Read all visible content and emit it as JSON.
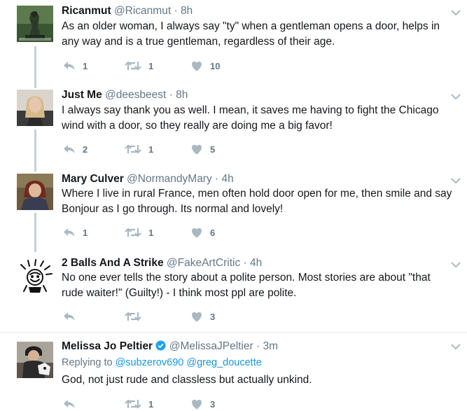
{
  "tweets": [
    {
      "name": "Ricanmut",
      "handle": "@Ricanmut",
      "dot": "·",
      "time": "8h",
      "text": "As an older woman, I always say \"ty\" when a gentleman opens a door, helps in any way and is a true gentleman, regardless of their age.",
      "reply_count": "1",
      "retweet_count": "1",
      "like_count": "10"
    },
    {
      "name": "Just Me",
      "handle": "@deesbeest",
      "dot": "·",
      "time": "8h",
      "text": "I always say thank you as well. I mean, it saves me having to fight the Chicago wind with a door, so they really are doing me a big favor!",
      "reply_count": "2",
      "retweet_count": "1",
      "like_count": "5"
    },
    {
      "name": "Mary Culver",
      "handle": "@NormandyMary",
      "dot": "·",
      "time": "4h",
      "text": "Where I live in rural France, men often hold door open for me, then smile and say Bonjour as I go through. Its normal and lovely!",
      "reply_count": "1",
      "retweet_count": "1",
      "like_count": "6"
    },
    {
      "name": "2 Balls And A Strike",
      "handle": "@FakeArtCritic",
      "dot": "·",
      "time": "4h",
      "text": "No one ever tells the story about a polite person. Most stories are about \"that rude waiter!\" (Guilty!) - I think most ppl are polite.",
      "reply_count": "",
      "retweet_count": "",
      "like_count": "3"
    },
    {
      "name": "Melissa Jo Peltier",
      "handle": "@MelissaJPeltier",
      "dot": "·",
      "time": "3m",
      "replying_prefix": "Replying to",
      "replying_to_1": "@subzerov690",
      "replying_to_2": "@greg_doucette",
      "text": "God, not just rude and classless but actually unkind.",
      "reply_count": "",
      "retweet_count": "1",
      "like_count": "3"
    }
  ],
  "colors": {
    "name": "#14171a",
    "meta": "#657786",
    "action_icon": "#aab8c2",
    "thread_line": "#c4cfd6",
    "link": "#1b95e0",
    "verified": "#1da1f2"
  },
  "icons": {
    "reply": "reply-icon",
    "retweet": "retweet-icon",
    "like": "heart-icon",
    "menu": "chevron-down-icon",
    "verified": "verified-badge-icon"
  }
}
